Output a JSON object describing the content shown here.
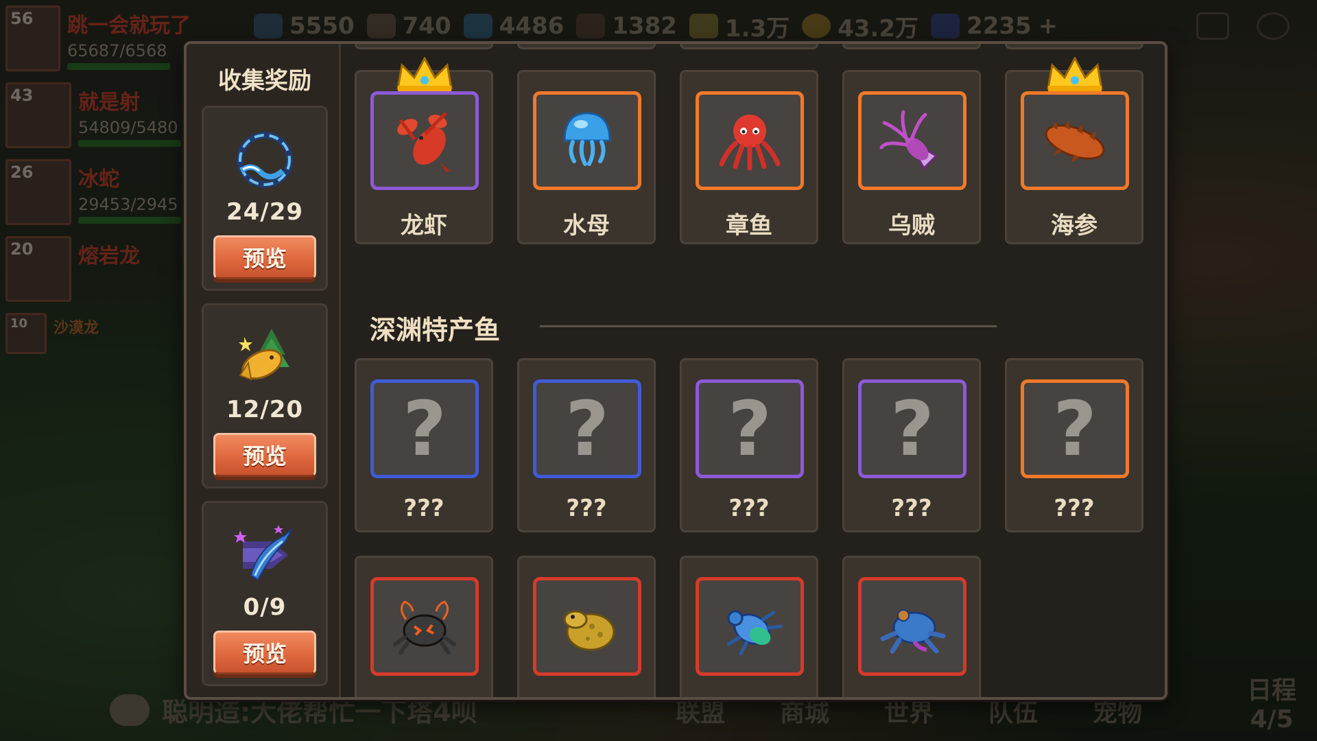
{
  "topbar": {
    "resources": [
      "5550",
      "740",
      "4486",
      "1382",
      "1.3万",
      "43.2万",
      "2235"
    ]
  },
  "players": [
    {
      "level": "56",
      "name": "跳一会就玩了",
      "hp": "65687/6568"
    },
    {
      "level": "43",
      "name": "就是射",
      "hp": "54809/5480"
    },
    {
      "level": "26",
      "name": "冰蛇",
      "hp": "29453/2945"
    },
    {
      "level": "20",
      "name": "熔岩龙",
      "hp": ""
    },
    {
      "level": "10",
      "name": "沙漠龙",
      "hp": ""
    }
  ],
  "reward_panel": {
    "title": "收集奖励",
    "cards": [
      {
        "icon": "wave-ring-icon",
        "count": "24/29",
        "button": "预览"
      },
      {
        "icon": "golden-fish-icon",
        "count": "12/20",
        "button": "预览"
      },
      {
        "icon": "swordfish-icon",
        "count": "0/9",
        "button": "预览"
      }
    ]
  },
  "row1": [
    {
      "name": "龙虾",
      "rarity": "purple",
      "icon": "lobster-icon",
      "crown": true
    },
    {
      "name": "水母",
      "rarity": "orange",
      "icon": "jellyfish-icon",
      "crown": false
    },
    {
      "name": "章鱼",
      "rarity": "orange",
      "icon": "octopus-icon",
      "crown": false
    },
    {
      "name": "乌贼",
      "rarity": "orange",
      "icon": "squid-icon",
      "crown": false
    },
    {
      "name": "海参",
      "rarity": "orange",
      "icon": "sea-cucumber-icon",
      "crown": true
    }
  ],
  "section": {
    "title": "深渊特产鱼"
  },
  "row2": [
    {
      "name": "???",
      "rarity": "blue",
      "mark": "?"
    },
    {
      "name": "???",
      "rarity": "blue",
      "mark": "?"
    },
    {
      "name": "???",
      "rarity": "purple",
      "mark": "?"
    },
    {
      "name": "???",
      "rarity": "purple",
      "mark": "?"
    },
    {
      "name": "???",
      "rarity": "orange",
      "mark": "?"
    }
  ],
  "row3": [
    {
      "rarity": "red",
      "icon": "lava-crab-icon"
    },
    {
      "rarity": "red",
      "icon": "golden-toad-icon"
    },
    {
      "rarity": "red",
      "icon": "blue-beetle-icon"
    },
    {
      "rarity": "red",
      "icon": "blue-frog-icon"
    }
  ],
  "chat": {
    "text": "聪明造:大佬帮忙一下塔4呗"
  },
  "nav": [
    "联盟",
    "商城",
    "世界",
    "队伍",
    "宠物"
  ],
  "schedule": {
    "label": "日程",
    "value": "4/5"
  },
  "colors": {
    "purple": "#8c5ad6",
    "orange": "#f07a2a",
    "blue": "#3f5bd6",
    "red": "#d63a2a",
    "button": "#e0683e"
  }
}
